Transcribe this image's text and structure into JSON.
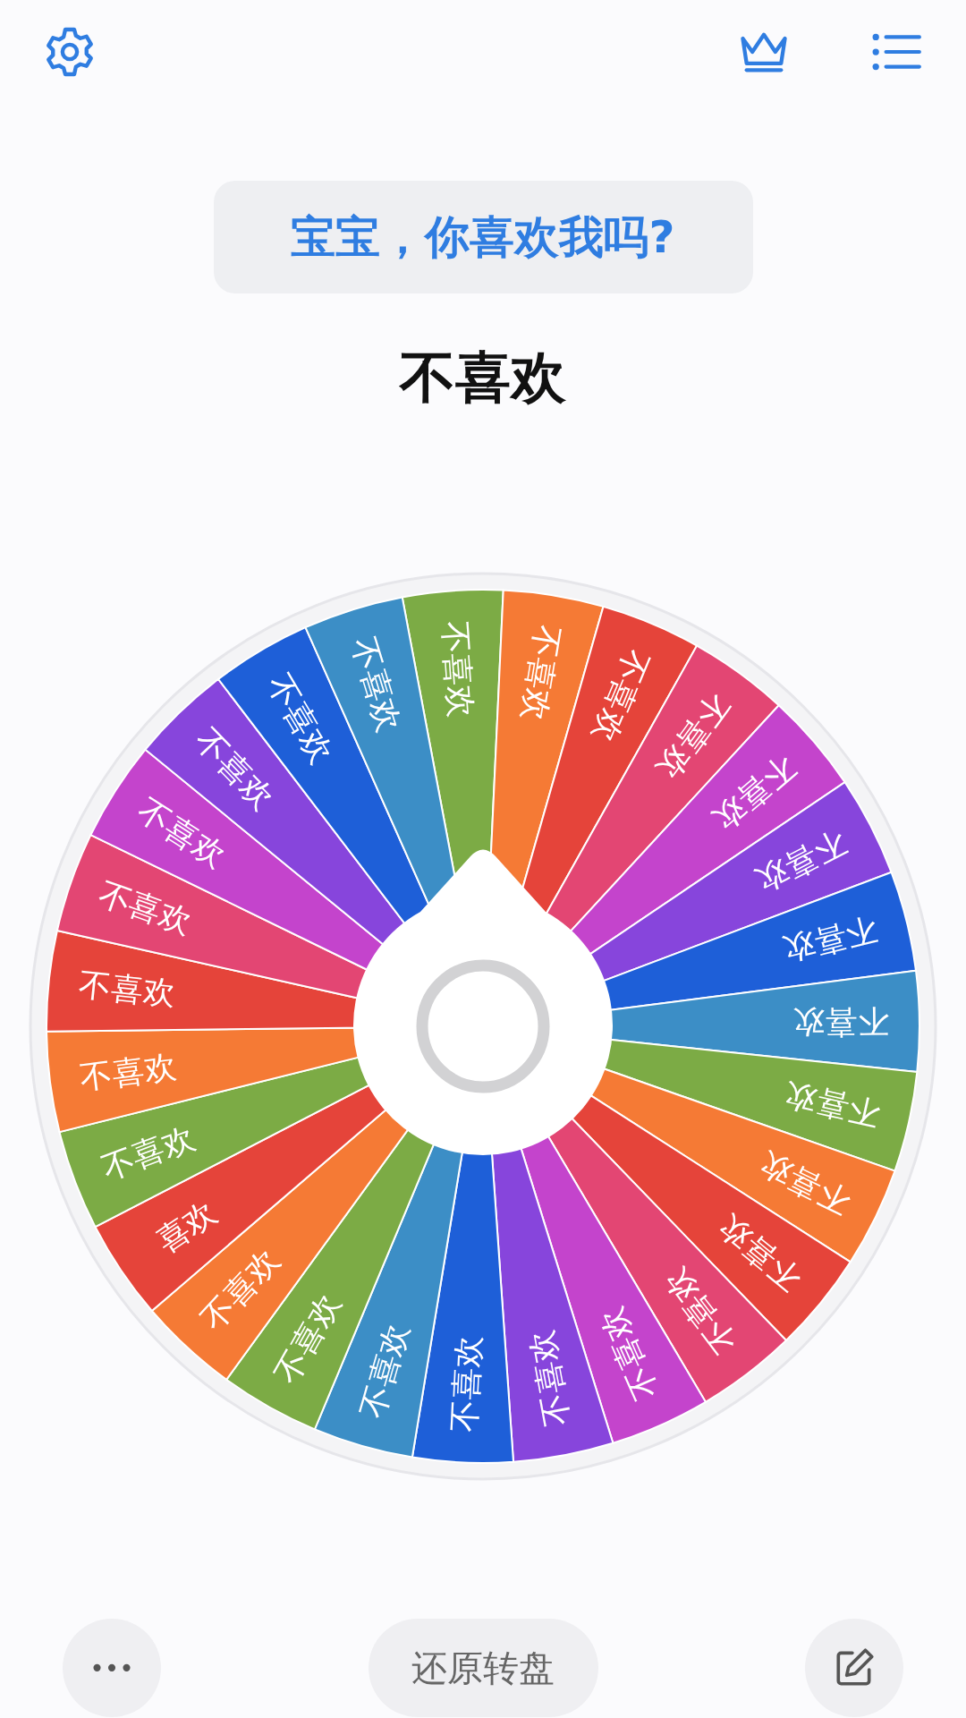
{
  "title": "宝宝，你喜欢我吗?",
  "result": "不喜欢",
  "segments": [
    {
      "label": "不喜欢",
      "color": "#7cab45"
    },
    {
      "label": "不喜欢",
      "color": "#f57a35"
    },
    {
      "label": "不喜欢",
      "color": "#e5443a"
    },
    {
      "label": "不喜欢",
      "color": "#e34673"
    },
    {
      "label": "不喜欢",
      "color": "#c444cc"
    },
    {
      "label": "不喜欢",
      "color": "#8745dc"
    },
    {
      "label": "不喜欢",
      "color": "#1e5fd8"
    },
    {
      "label": "不喜欢",
      "color": "#3c8ec6"
    },
    {
      "label": "不喜欢",
      "color": "#7cab45"
    },
    {
      "label": "不喜欢",
      "color": "#f57a35"
    },
    {
      "label": "不喜欢",
      "color": "#e5443a"
    },
    {
      "label": "不喜欢",
      "color": "#e34673"
    },
    {
      "label": "不喜欢",
      "color": "#c444cc"
    },
    {
      "label": "不喜欢",
      "color": "#8745dc"
    },
    {
      "label": "不喜欢",
      "color": "#1e5fd8"
    },
    {
      "label": "不喜欢",
      "color": "#3c8ec6"
    },
    {
      "label": "不喜欢",
      "color": "#7cab45"
    },
    {
      "label": "不喜欢",
      "color": "#f57a35"
    },
    {
      "label": "喜欢",
      "color": "#e5443a"
    },
    {
      "label": "不喜欢",
      "color": "#7cab45"
    },
    {
      "label": "不喜欢",
      "color": "#f57a35"
    },
    {
      "label": "不喜欢",
      "color": "#e5443a"
    },
    {
      "label": "不喜欢",
      "color": "#e34673"
    },
    {
      "label": "不喜欢",
      "color": "#c444cc"
    },
    {
      "label": "不喜欢",
      "color": "#8745dc"
    },
    {
      "label": "不喜欢",
      "color": "#1e5fd8"
    },
    {
      "label": "不喜欢",
      "color": "#3c8ec6"
    }
  ],
  "more_button": "•••",
  "reset_button": "还原转盘"
}
